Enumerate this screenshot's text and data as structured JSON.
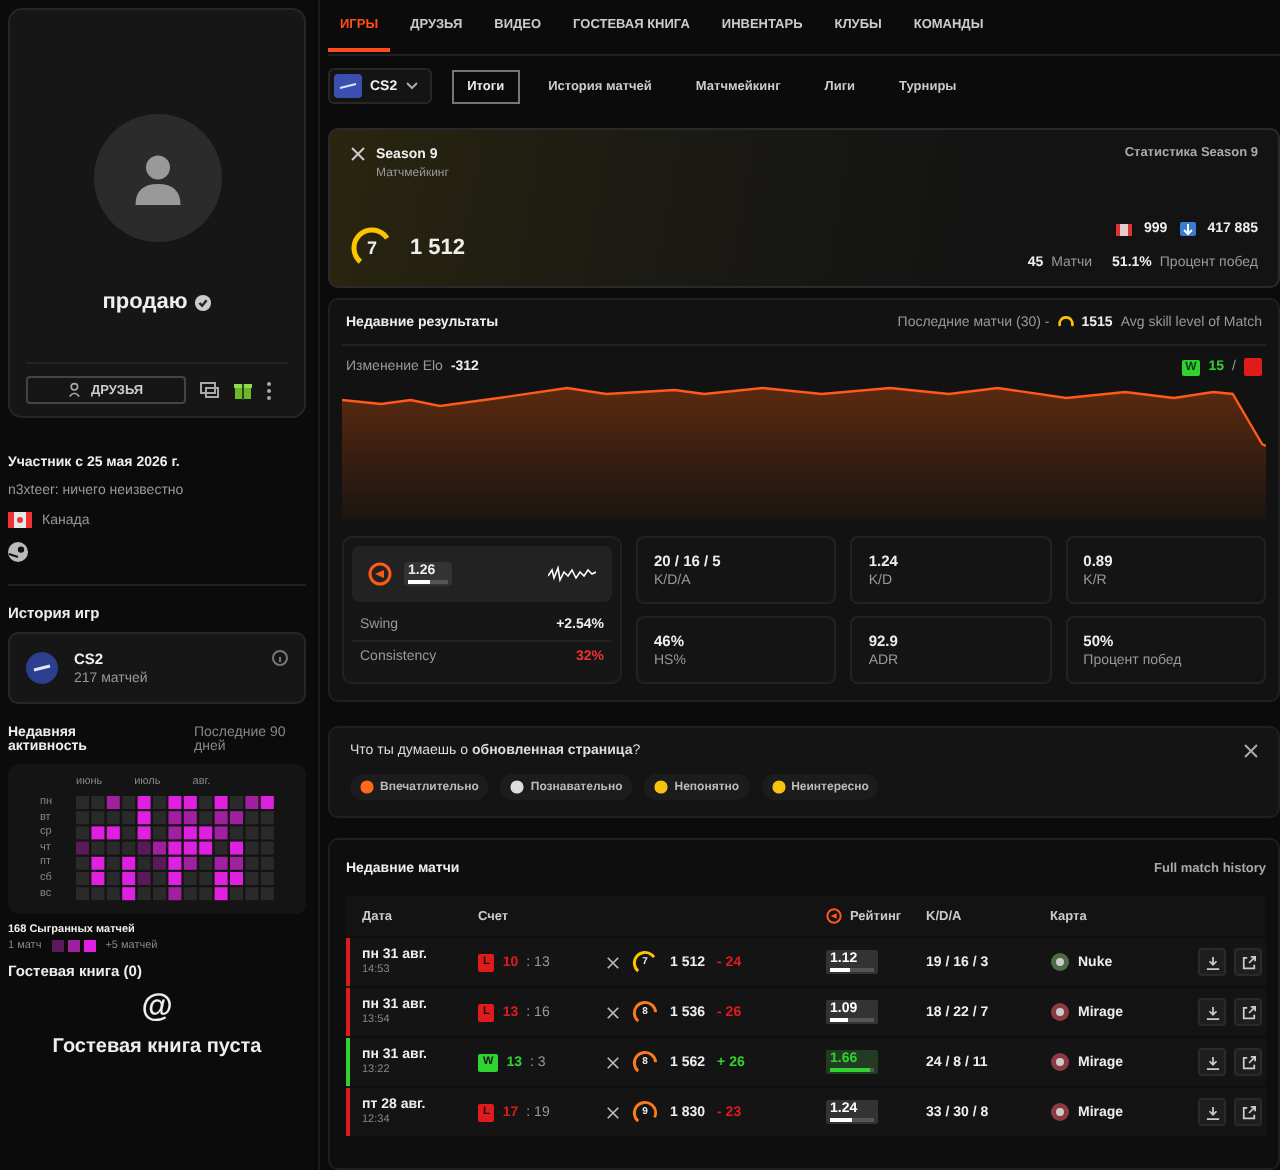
{
  "profile": {
    "name": "продаю",
    "friends_button": "ДРУЗЬЯ",
    "member_since": "Участник с 25 мая 2026 г.",
    "bio": "n3xteer: ничего неизвестно",
    "country": "Канада"
  },
  "game_history": {
    "title": "История игр",
    "game": "CS2",
    "matches": "217 матчей"
  },
  "activity": {
    "title": "Недавняя активность",
    "period": "Последние 90 дней",
    "months": [
      "июнь",
      "июль",
      "авг."
    ],
    "days": [
      "пн",
      "вт",
      "ср",
      "чт",
      "пт",
      "сб",
      "вс"
    ],
    "total": "168 Сыгранных матчей",
    "legend_min": "1 матч",
    "legend_max": "+5 матчей"
  },
  "guestbook": {
    "title": "Гостевая книга (0)",
    "symbol": "@",
    "empty": "Гостевая книга пуста"
  },
  "tabs": [
    {
      "label": "ИГРЫ",
      "selected": true
    },
    {
      "label": "ДРУЗЬЯ",
      "selected": false
    },
    {
      "label": "ВИДЕО",
      "selected": false
    },
    {
      "label": "ГОСТЕВАЯ КНИГА",
      "selected": false
    },
    {
      "label": "ИНВЕНТАРЬ",
      "selected": false
    },
    {
      "label": "КЛУБЫ",
      "selected": false
    },
    {
      "label": "КОМАНДЫ",
      "selected": false
    }
  ],
  "game_selector": {
    "value": "CS2"
  },
  "subtabs": [
    {
      "label": "Итоги",
      "selected": true
    },
    {
      "label": "История матчей",
      "selected": false
    },
    {
      "label": "Матчмейкинг",
      "selected": false
    },
    {
      "label": "Лиги",
      "selected": false
    },
    {
      "label": "Турниры",
      "selected": false
    }
  ],
  "season": {
    "title": "Season 9",
    "subtitle": "Матчмейкинг",
    "stats_link": "Статистика Season 9",
    "level": "7",
    "elo": "1 512",
    "country_rank": "999",
    "world_rank": "417 885",
    "matches": "45",
    "matches_label": "Матчи",
    "winrate": "51.1%",
    "winrate_label": "Процент побед"
  },
  "results": {
    "title": "Недавние результаты",
    "recent": "Последние матчи (30) -",
    "avg_skill": "1515",
    "avg_label": "Avg skill level of Match",
    "elo_change_label": "Изменение Elo",
    "elo_change": "-312",
    "win_badge": "W",
    "wins": "15",
    "separator": "/",
    "rating": {
      "value": "1.26",
      "level": 0.55
    },
    "swing_label": "Swing",
    "swing": "+2.54%",
    "consistency_label": "Consistency",
    "consistency": "32%",
    "stats": [
      {
        "value": "20 / 16 / 5",
        "label": "K/D/A"
      },
      {
        "value": "1.24",
        "label": "K/D"
      },
      {
        "value": "0.89",
        "label": "K/R"
      },
      {
        "value": "46%",
        "label": "HS%"
      },
      {
        "value": "92.9",
        "label": "ADR"
      },
      {
        "value": "50%",
        "label": "Процент побед"
      }
    ]
  },
  "feedback": {
    "question": "Что ты думаешь о **обновленная страница**?",
    "options": [
      {
        "label": "Впечатлительно",
        "kind": "fire"
      },
      {
        "label": "Познавательно",
        "kind": "eyes"
      },
      {
        "label": "Непонятно",
        "kind": "confused"
      },
      {
        "label": "Неинтересно",
        "kind": "bored"
      }
    ]
  },
  "matches": {
    "title": "Недавние матчи",
    "history_link": "Full match history",
    "columns": [
      "Дата",
      "Счет",
      "Рейтинг",
      "K/D/A",
      "Карта"
    ],
    "rows": [
      {
        "date": "пн 31 авг.",
        "time": "14:53",
        "won": false,
        "badge": "L",
        "score": "10",
        "opponent": ": 13",
        "skill_level": "7",
        "elo": "1 512",
        "delta": "- 24",
        "rating": "1.12",
        "level": 0.45,
        "kda": "19 / 16 / 3",
        "map": "Nuke"
      },
      {
        "date": "пн 31 авг.",
        "time": "13:54",
        "won": false,
        "badge": "L",
        "score": "13",
        "opponent": ": 16",
        "skill_level": "8",
        "elo": "1 536",
        "delta": "- 26",
        "rating": "1.09",
        "level": 0.4,
        "kda": "18 / 22 / 7",
        "map": "Mirage"
      },
      {
        "date": "пн 31 авг.",
        "time": "13:22",
        "won": true,
        "badge": "W",
        "score": "13",
        "opponent": ": 3",
        "skill_level": "8",
        "elo": "1 562",
        "delta": "+ 26",
        "rating": "1.66",
        "level": 0.9,
        "kda": "24 / 8 / 11",
        "map": "Mirage"
      },
      {
        "date": "пт 28 авг.",
        "time": "12:34",
        "won": false,
        "badge": "L",
        "score": "17",
        "opponent": ": 19",
        "skill_level": "9",
        "elo": "1 830",
        "delta": "- 23",
        "rating": "1.24",
        "level": 0.5,
        "kda": "33 / 30 / 8",
        "map": "Mirage"
      }
    ]
  }
}
